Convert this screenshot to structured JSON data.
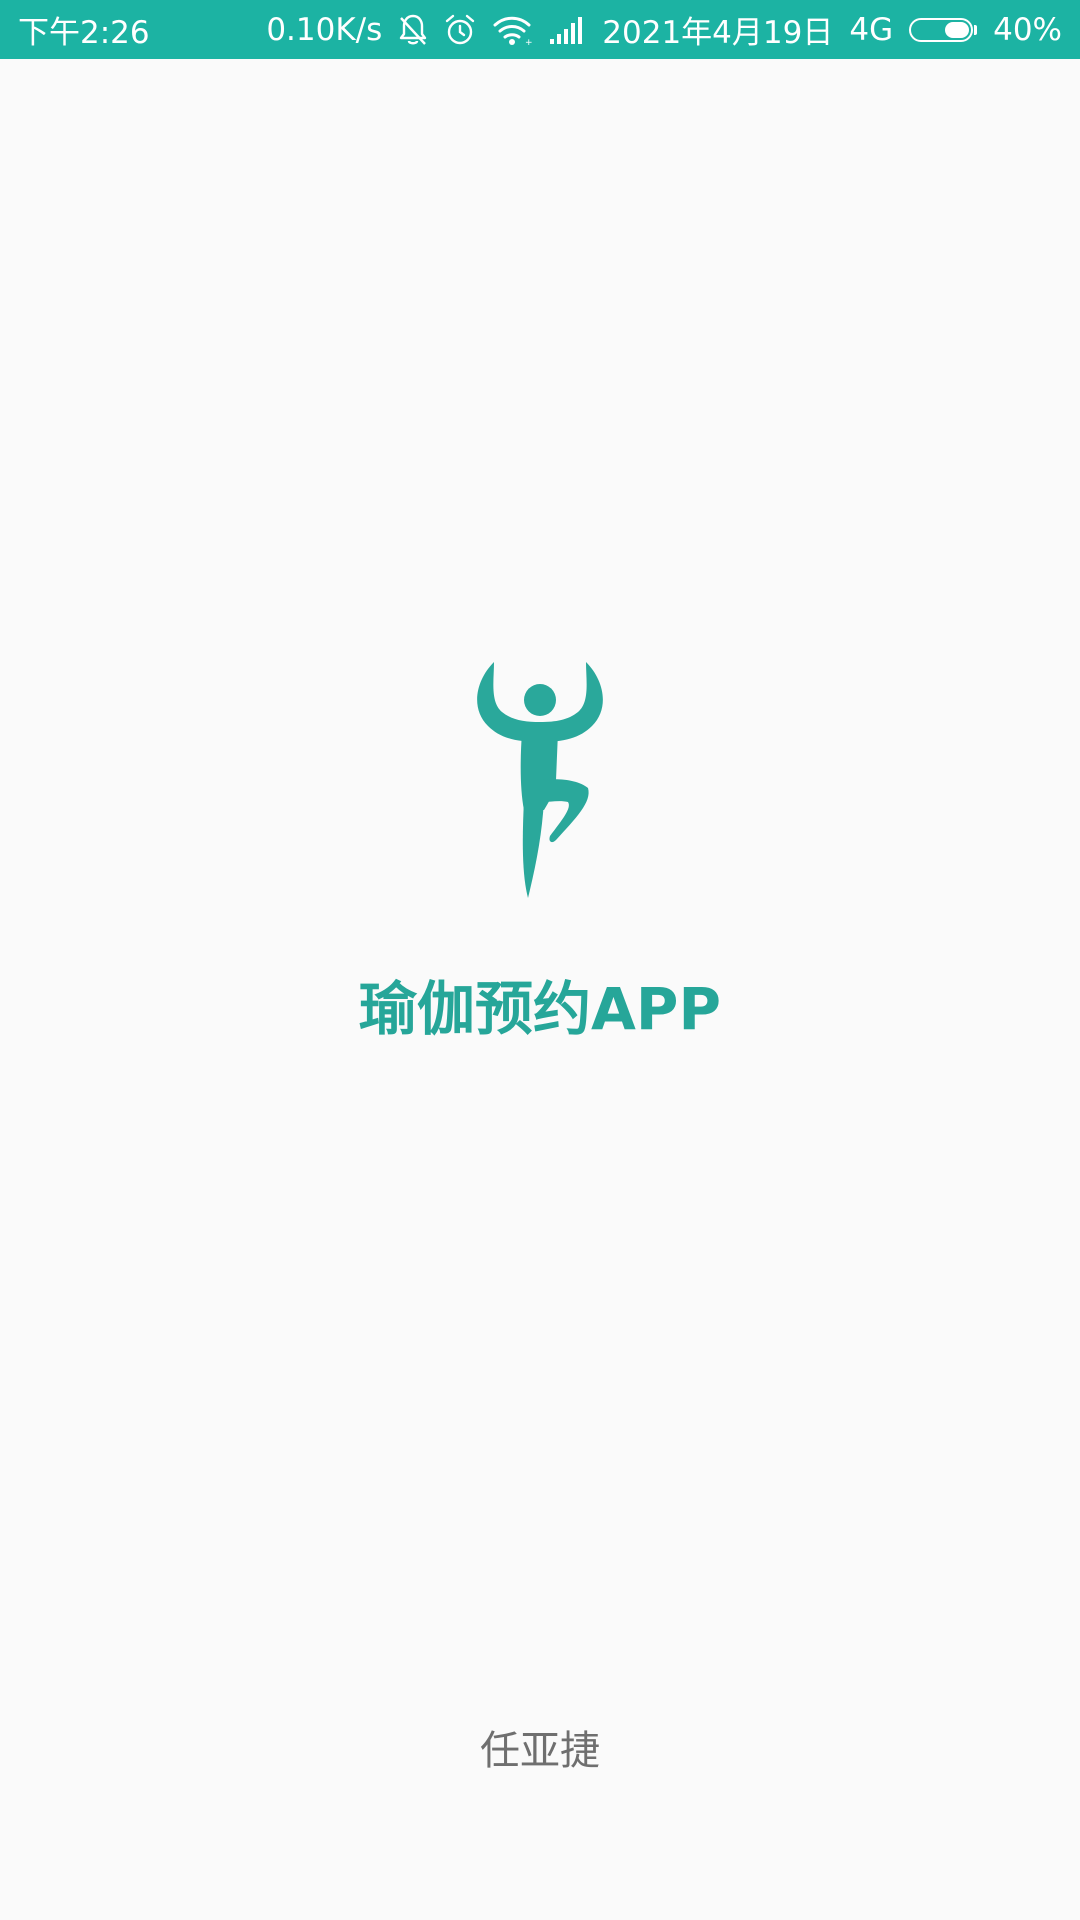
{
  "status_bar": {
    "time": "下午2:26",
    "network_speed": "0.10K/s",
    "date": "2021年4月19日",
    "network_type": "4G",
    "battery_percent_text": "40%",
    "battery_level": 0.4,
    "icons": [
      "bell-off-icon",
      "alarm-clock-icon",
      "wifi-icon",
      "signal-icon",
      "battery-icon"
    ],
    "background_color": "#1cb3a3"
  },
  "splash": {
    "logo_icon": "yoga-person-icon",
    "title": "瑜伽预约APP",
    "author": "任亚捷",
    "accent_color": "#26a699",
    "background_color": "#fafafa"
  }
}
